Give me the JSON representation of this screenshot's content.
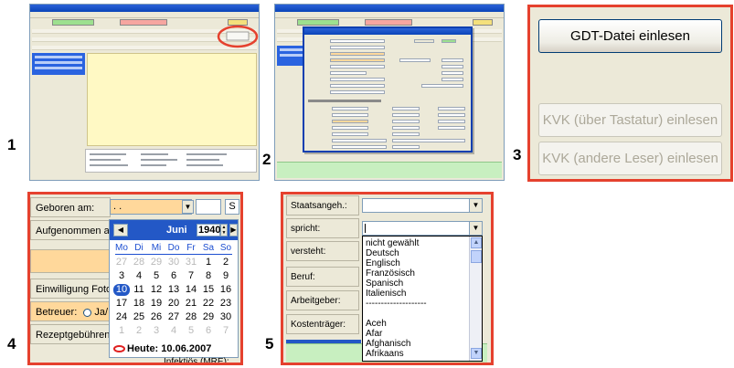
{
  "figure_numbers": [
    "1",
    "2",
    "3",
    "4",
    "5"
  ],
  "panel3": {
    "gdt_button": "GDT-Datei einlesen",
    "kvk_keyboard_button": "KVK (über Tastatur) einlesen",
    "kvk_other_button": "KVK (andere Leser) einlesen"
  },
  "panel4": {
    "labels": {
      "born": "Geboren am:",
      "admitted": "Aufgenommen am:",
      "consent": "Einwilligung Fotodol",
      "caregiver": "Betreuer:",
      "caregiver_option": "Ja/",
      "prescription_fee": "Rezeptgebührenbel",
      "infectious": "Infektiös (MRE):",
      "s_box": "S"
    },
    "date_value": ". .",
    "calendar": {
      "month": "Juni",
      "year": "1940",
      "weekdays": [
        "Mo",
        "Di",
        "Mi",
        "Do",
        "Fr",
        "Sa",
        "So"
      ],
      "days": [
        {
          "t": "27",
          "grey": true
        },
        {
          "t": "28",
          "grey": true
        },
        {
          "t": "29",
          "grey": true
        },
        {
          "t": "30",
          "grey": true
        },
        {
          "t": "31",
          "grey": true
        },
        {
          "t": "1"
        },
        {
          "t": "2"
        },
        {
          "t": "3"
        },
        {
          "t": "4"
        },
        {
          "t": "5"
        },
        {
          "t": "6"
        },
        {
          "t": "7"
        },
        {
          "t": "8"
        },
        {
          "t": "9"
        },
        {
          "t": "10",
          "sel": true
        },
        {
          "t": "11"
        },
        {
          "t": "12"
        },
        {
          "t": "13"
        },
        {
          "t": "14"
        },
        {
          "t": "15"
        },
        {
          "t": "16"
        },
        {
          "t": "17"
        },
        {
          "t": "18"
        },
        {
          "t": "19"
        },
        {
          "t": "20"
        },
        {
          "t": "21"
        },
        {
          "t": "22"
        },
        {
          "t": "23"
        },
        {
          "t": "24"
        },
        {
          "t": "25"
        },
        {
          "t": "26"
        },
        {
          "t": "27"
        },
        {
          "t": "28"
        },
        {
          "t": "29"
        },
        {
          "t": "30"
        },
        {
          "t": "1",
          "grey": true
        },
        {
          "t": "2",
          "grey": true
        },
        {
          "t": "3",
          "grey": true
        },
        {
          "t": "4",
          "grey": true
        },
        {
          "t": "5",
          "grey": true
        },
        {
          "t": "6",
          "grey": true
        },
        {
          "t": "7",
          "grey": true
        }
      ],
      "today": "Heute: 10.06.2007"
    }
  },
  "panel5": {
    "labels": {
      "nationality": "Staatsangeh.:",
      "speaks": "spricht:",
      "understands": "versteht:",
      "profession": "Beruf:",
      "employer": "Arbeitgeber:",
      "insurer": "Kostenträger:"
    },
    "languages": [
      "nicht gewählt",
      "Deutsch",
      "Englisch",
      "Französisch",
      "Spanisch",
      "Italienisch",
      "--------------------",
      "",
      "Aceh",
      "Afar",
      "Afghanisch",
      "Afrikaans"
    ]
  },
  "colors": {
    "highlight_frame": "#e5412e",
    "xp_blue": "#2358c6",
    "field_orange": "#ffd89b",
    "status_green": "#c8efc0"
  }
}
